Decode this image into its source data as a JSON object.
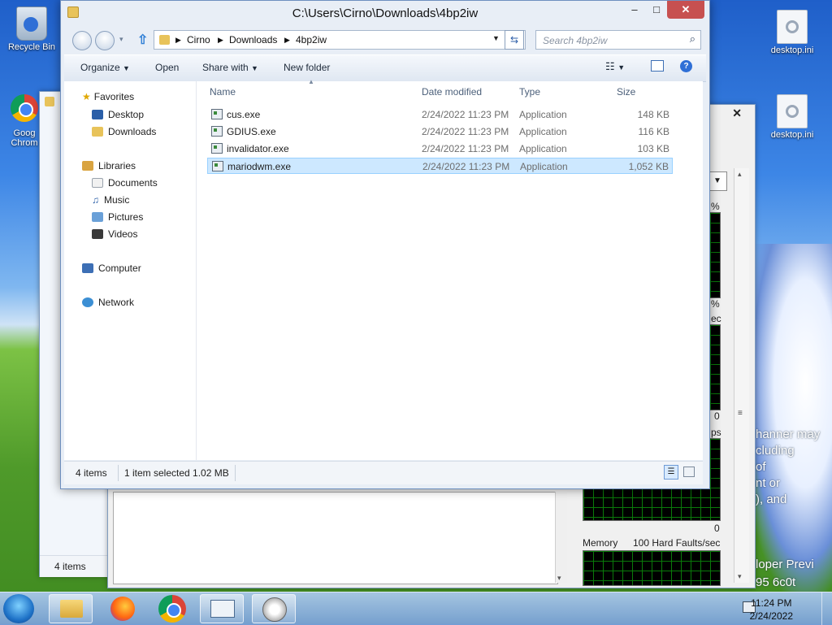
{
  "desktop": {
    "icons": [
      {
        "label": "Recycle Bin"
      },
      {
        "label": "Goog Chrom"
      },
      {
        "label": "desktop.ini"
      },
      {
        "label": "desktop.ini"
      }
    ],
    "wallpaper_text": [
      "hanner may",
      "cluding",
      "of",
      "nt or",
      "), and",
      "loper Previ",
      "95  6c0t"
    ]
  },
  "background_window": {
    "status": "4 items",
    "perf_labels": {
      "pct1": "%",
      "pct2": "%",
      "sec": "ec",
      "ps": "ps",
      "zero1": "0",
      "zero2": "0",
      "memory": "Memory",
      "faults": "100 Hard Faults/sec"
    }
  },
  "window": {
    "title": "C:\\Users\\Cirno\\Downloads\\4bp2iw",
    "controls": {
      "minimize": "–",
      "maximize": "□",
      "close": "✕"
    },
    "breadcrumb": [
      "Cirno",
      "Downloads",
      "4bp2iw"
    ],
    "search_placeholder": "Search 4bp2iw",
    "toolbar": {
      "organize": "Organize",
      "open": "Open",
      "share_with": "Share with",
      "new_folder": "New folder"
    },
    "nav": {
      "favorites": "Favorites",
      "desktop": "Desktop",
      "downloads": "Downloads",
      "libraries": "Libraries",
      "documents": "Documents",
      "music": "Music",
      "pictures": "Pictures",
      "videos": "Videos",
      "computer": "Computer",
      "network": "Network"
    },
    "columns": {
      "name": "Name",
      "date": "Date modified",
      "type": "Type",
      "size": "Size"
    },
    "files": [
      {
        "name": "cus.exe",
        "date": "2/24/2022 11:23 PM",
        "type": "Application",
        "size": "148 KB"
      },
      {
        "name": "GDIUS.exe",
        "date": "2/24/2022 11:23 PM",
        "type": "Application",
        "size": "116 KB"
      },
      {
        "name": "invalidator.exe",
        "date": "2/24/2022 11:23 PM",
        "type": "Application",
        "size": "103 KB"
      },
      {
        "name": "mariodwm.exe",
        "date": "2/24/2022 11:23 PM",
        "type": "Application",
        "size": "1,052 KB"
      }
    ],
    "status": {
      "count": "4 items",
      "selection": "1 item selected  1.02 MB"
    }
  },
  "taskbar": {
    "time": "11:24 PM",
    "date": "2/24/2022"
  },
  "colors": {
    "accent": "#3399ff",
    "selection": "#cde8ff",
    "close": "#c75050"
  }
}
